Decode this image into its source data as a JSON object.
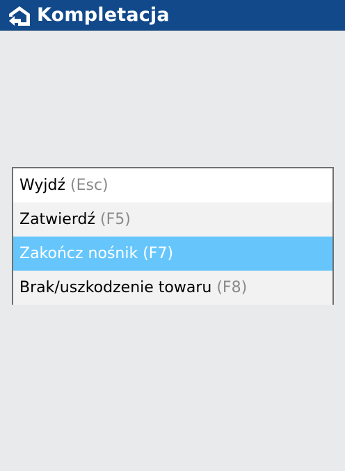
{
  "header": {
    "title": "Kompletacja",
    "back_icon": "home-back-icon",
    "background": "#11498a"
  },
  "menu": {
    "items": [
      {
        "label": "Wyjdź",
        "shortcut": "(Esc)",
        "selected": false
      },
      {
        "label": "Zatwierdź",
        "shortcut": "(F5)",
        "selected": false
      },
      {
        "label": "Zakończ nośnik",
        "shortcut": "(F7)",
        "selected": true
      },
      {
        "label": "Brak/uszkodzenie towaru",
        "shortcut": "(F8)",
        "selected": false
      }
    ],
    "selected_color": "#66c6fc"
  }
}
